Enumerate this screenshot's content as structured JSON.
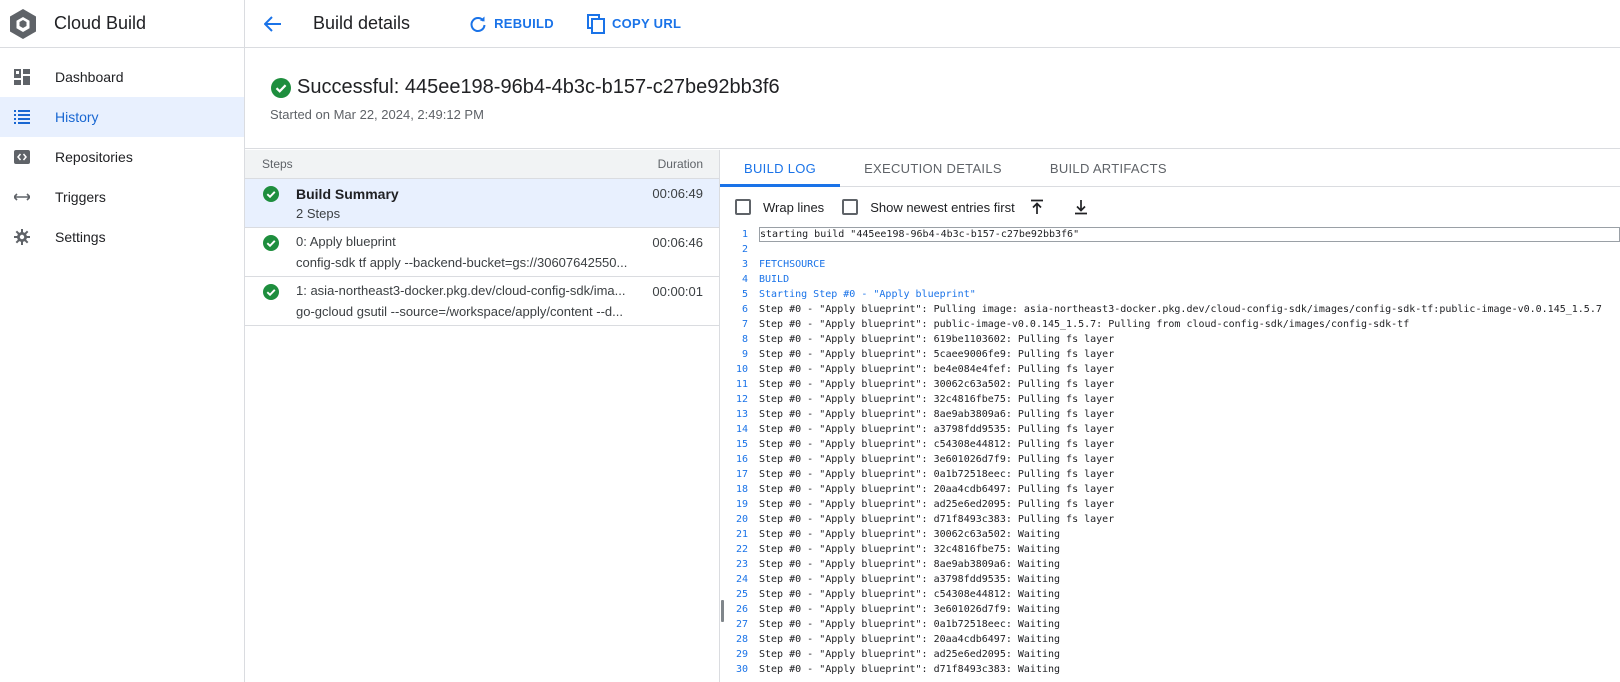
{
  "app": {
    "title": "Cloud Build",
    "logo_icon": "cloud-build-logo"
  },
  "sidebar": {
    "items": [
      {
        "label": "Dashboard",
        "icon": "dashboard-icon",
        "active": false
      },
      {
        "label": "History",
        "icon": "history-list-icon",
        "active": true
      },
      {
        "label": "Repositories",
        "icon": "repositories-icon",
        "active": false
      },
      {
        "label": "Triggers",
        "icon": "triggers-icon",
        "active": false
      },
      {
        "label": "Settings",
        "icon": "gear-icon",
        "active": false
      }
    ]
  },
  "header": {
    "title": "Build details",
    "rebuild_label": "REBUILD",
    "copy_url_label": "COPY URL"
  },
  "status": {
    "text": "Successful: 445ee198-96b4-4b3c-b157-c27be92bb3f6",
    "started": "Started on Mar 22, 2024, 2:49:12 PM"
  },
  "steps": {
    "col_steps": "Steps",
    "col_duration": "Duration",
    "rows": [
      {
        "title": "Build Summary",
        "subtitle": "2 Steps",
        "duration": "00:06:49"
      },
      {
        "title": "0: Apply blueprint",
        "subtitle": "config-sdk tf apply --backend-bucket=gs://30607642550...",
        "duration": "00:06:46"
      },
      {
        "title": "1: asia-northeast3-docker.pkg.dev/cloud-config-sdk/ima...",
        "subtitle": "go-gcloud gsutil --source=/workspace/apply/content --d...",
        "duration": "00:00:01"
      }
    ]
  },
  "log_tabs": [
    "BUILD LOG",
    "EXECUTION DETAILS",
    "BUILD ARTIFACTS"
  ],
  "log_tools": {
    "wrap_lines": "Wrap lines",
    "show_newest": "Show newest entries first"
  },
  "log_lines": [
    {
      "n": "1",
      "t": "starting build \"445ee198-96b4-4b3c-b157-c27be92bb3f6\""
    },
    {
      "n": "2",
      "t": ""
    },
    {
      "n": "3",
      "t": "FETCHSOURCE"
    },
    {
      "n": "4",
      "t": "BUILD"
    },
    {
      "n": "5",
      "t": "Starting Step #0 - \"Apply blueprint\""
    },
    {
      "n": "6",
      "t": "Step #0 - \"Apply blueprint\": Pulling image: asia-northeast3-docker.pkg.dev/cloud-config-sdk/images/config-sdk-tf:public-image-v0.0.145_1.5.7"
    },
    {
      "n": "7",
      "t": "Step #0 - \"Apply blueprint\": public-image-v0.0.145_1.5.7: Pulling from cloud-config-sdk/images/config-sdk-tf"
    },
    {
      "n": "8",
      "t": "Step #0 - \"Apply blueprint\": 619be1103602: Pulling fs layer"
    },
    {
      "n": "9",
      "t": "Step #0 - \"Apply blueprint\": 5caee9006fe9: Pulling fs layer"
    },
    {
      "n": "10",
      "t": "Step #0 - \"Apply blueprint\": be4e084e4fef: Pulling fs layer"
    },
    {
      "n": "11",
      "t": "Step #0 - \"Apply blueprint\": 30062c63a502: Pulling fs layer"
    },
    {
      "n": "12",
      "t": "Step #0 - \"Apply blueprint\": 32c4816fbe75: Pulling fs layer"
    },
    {
      "n": "13",
      "t": "Step #0 - \"Apply blueprint\": 8ae9ab3809a6: Pulling fs layer"
    },
    {
      "n": "14",
      "t": "Step #0 - \"Apply blueprint\": a3798fdd9535: Pulling fs layer"
    },
    {
      "n": "15",
      "t": "Step #0 - \"Apply blueprint\": c54308e44812: Pulling fs layer"
    },
    {
      "n": "16",
      "t": "Step #0 - \"Apply blueprint\": 3e601026d7f9: Pulling fs layer"
    },
    {
      "n": "17",
      "t": "Step #0 - \"Apply blueprint\": 0a1b72518eec: Pulling fs layer"
    },
    {
      "n": "18",
      "t": "Step #0 - \"Apply blueprint\": 20aa4cdb6497: Pulling fs layer"
    },
    {
      "n": "19",
      "t": "Step #0 - \"Apply blueprint\": ad25e6ed2095: Pulling fs layer"
    },
    {
      "n": "20",
      "t": "Step #0 - \"Apply blueprint\": d71f8493c383: Pulling fs layer"
    },
    {
      "n": "21",
      "t": "Step #0 - \"Apply blueprint\": 30062c63a502: Waiting"
    },
    {
      "n": "22",
      "t": "Step #0 - \"Apply blueprint\": 32c4816fbe75: Waiting"
    },
    {
      "n": "23",
      "t": "Step #0 - \"Apply blueprint\": 8ae9ab3809a6: Waiting"
    },
    {
      "n": "24",
      "t": "Step #0 - \"Apply blueprint\": a3798fdd9535: Waiting"
    },
    {
      "n": "25",
      "t": "Step #0 - \"Apply blueprint\": c54308e44812: Waiting"
    },
    {
      "n": "26",
      "t": "Step #0 - \"Apply blueprint\": 3e601026d7f9: Waiting"
    },
    {
      "n": "27",
      "t": "Step #0 - \"Apply blueprint\": 0a1b72518eec: Waiting"
    },
    {
      "n": "28",
      "t": "Step #0 - \"Apply blueprint\": 20aa4cdb6497: Waiting"
    },
    {
      "n": "29",
      "t": "Step #0 - \"Apply blueprint\": ad25e6ed2095: Waiting"
    },
    {
      "n": "30",
      "t": "Step #0 - \"Apply blueprint\": d71f8493c383: Waiting"
    }
  ],
  "colors": {
    "accent": "#1a73e8",
    "success": "#1e8e3e",
    "active_bg": "#e8f0fe"
  }
}
